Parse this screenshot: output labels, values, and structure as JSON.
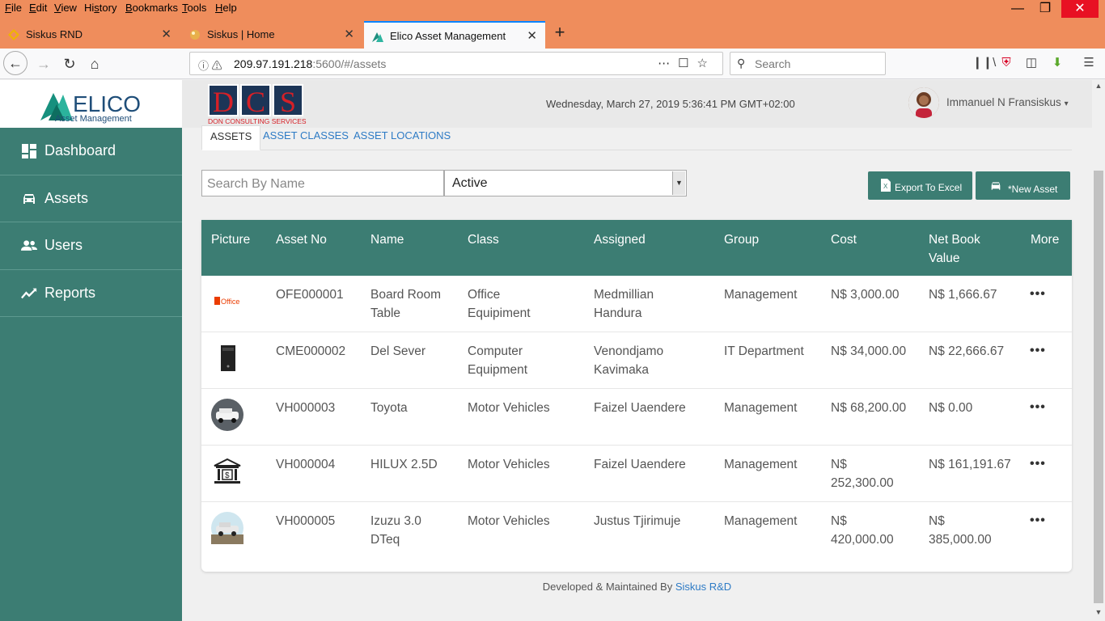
{
  "menubar": {
    "items": [
      {
        "label": "File",
        "u": "F"
      },
      {
        "label": "Edit",
        "u": "E"
      },
      {
        "label": "View",
        "u": "V"
      },
      {
        "label": "History",
        "u": "s"
      },
      {
        "label": "Bookmarks",
        "u": "B"
      },
      {
        "label": "Tools",
        "u": "T"
      },
      {
        "label": "Help",
        "u": "H"
      }
    ]
  },
  "browser": {
    "tabs": [
      {
        "label": "Siskus RND",
        "icon": "siskus-icon"
      },
      {
        "label": "Siskus | Home",
        "icon": "siskus-home-icon"
      },
      {
        "label": "Elico Asset Management",
        "icon": "elico-icon"
      }
    ],
    "url_host": "209.97.191.218",
    "url_rest": ":5600/#/assets",
    "search_placeholder": "Search"
  },
  "brand": {
    "logo_text": "ELICO",
    "logo_sub": "Asset Management",
    "dcs_letters": [
      "D",
      "C",
      "S"
    ],
    "dcs_sub": "DON CONSULTING SERVICES"
  },
  "sidebar": {
    "items": [
      {
        "label": "Dashboard",
        "icon": "dashboard-icon"
      },
      {
        "label": "Assets",
        "icon": "car-icon"
      },
      {
        "label": "Users",
        "icon": "users-icon"
      },
      {
        "label": "Reports",
        "icon": "chart-line-icon"
      }
    ]
  },
  "header": {
    "datetime": "Wednesday, March 27, 2019 5:36:41 PM GMT+02:00",
    "user": "Immanuel N Fransiskus",
    "user_caret": "▾"
  },
  "tabs": [
    "ASSETS",
    "ASSET CLASSES",
    "ASSET LOCATIONS"
  ],
  "filters": {
    "search_placeholder": "Search By Name",
    "status_selected": "Active"
  },
  "actions": {
    "export_label": "Export To Excel",
    "new_label": "*New Asset"
  },
  "table": {
    "columns": [
      "Picture",
      "Asset No",
      "Name",
      "Class",
      "Assigned",
      "Group",
      "Cost",
      "Net Book Value",
      "More"
    ],
    "rows": [
      {
        "picture": "office-logo",
        "asset_no": "OFE000001",
        "name": "Board Room Table",
        "class": "Office Equipiment",
        "assigned": "Medmillian Handura",
        "group": "Management",
        "cost": "N$ 3,000.00",
        "nbv": "N$ 1,666.67"
      },
      {
        "picture": "server-image",
        "asset_no": "CME000002",
        "name": "Del Sever",
        "class": "Computer Equipment",
        "assigned": "Venondjamo Kavimaka",
        "group": "IT Department",
        "cost": "N$ 34,000.00",
        "nbv": "N$ 22,666.67"
      },
      {
        "picture": "vehicle-photo",
        "asset_no": "VH000003",
        "name": "Toyota",
        "class": "Motor Vehicles",
        "assigned": "Faizel Uaendere",
        "group": "Management",
        "cost": "N$ 68,200.00",
        "nbv": "N$ 0.00"
      },
      {
        "picture": "bank-icon",
        "asset_no": "VH000004",
        "name": "HILUX 2.5D",
        "class": "Motor Vehicles",
        "assigned": "Faizel Uaendere",
        "group": "Management",
        "cost": "N$ 252,300.00",
        "nbv": "N$ 161,191.67"
      },
      {
        "picture": "vehicle-photo",
        "asset_no": "VH000005",
        "name": "Izuzu 3.0 DTeq",
        "class": "Motor Vehicles",
        "assigned": "Justus Tjirimuje",
        "group": "Management",
        "cost": "N$ 420,000.00",
        "nbv": "N$ 385,000.00"
      }
    ],
    "office_logo_text": "Office",
    "more_glyph": "•••"
  },
  "footer": {
    "text": "Developed & Maintained By ",
    "link": "Siskus R&D"
  },
  "colors": {
    "accent": "#3c7d73",
    "link": "#2e7bc5",
    "browser_chrome": "#ef8d5c"
  }
}
